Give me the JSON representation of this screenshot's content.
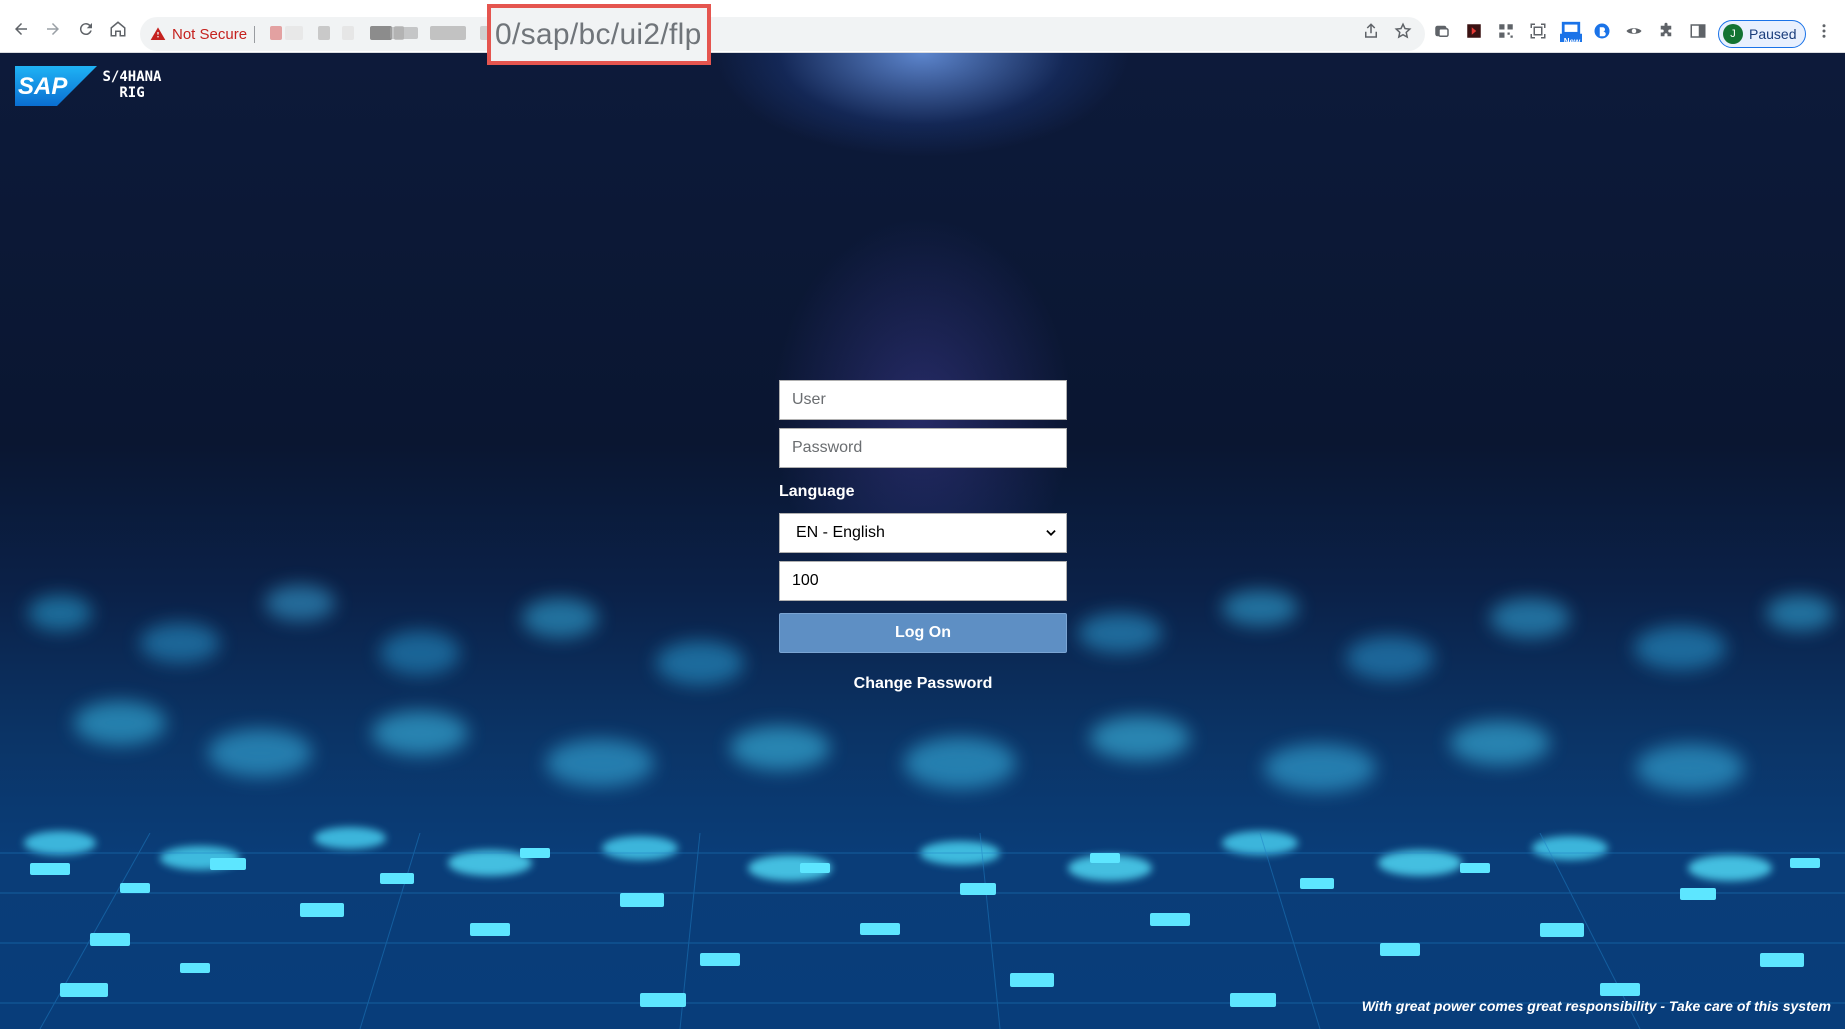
{
  "browser": {
    "security_label": "Not Secure",
    "url_visible": "0/sap/bc/ui2/flp",
    "profile_initial": "J",
    "profile_status": "Paused",
    "extension_badge": "New"
  },
  "page": {
    "brand": "SAP",
    "product_line1": "S/4HANA",
    "product_line2": "RIG",
    "login": {
      "user_placeholder": "User",
      "password_placeholder": "Password",
      "language_label": "Language",
      "language_selected": "EN - English",
      "client_value": "100",
      "logon_label": "Log On",
      "change_password_label": "Change Password"
    },
    "footer": "With great power comes great responsibility - Take care of this system"
  },
  "colors": {
    "accent_button": "#5e8fc4",
    "warning_red": "#c5221f",
    "highlight_border": "#e5554f"
  }
}
